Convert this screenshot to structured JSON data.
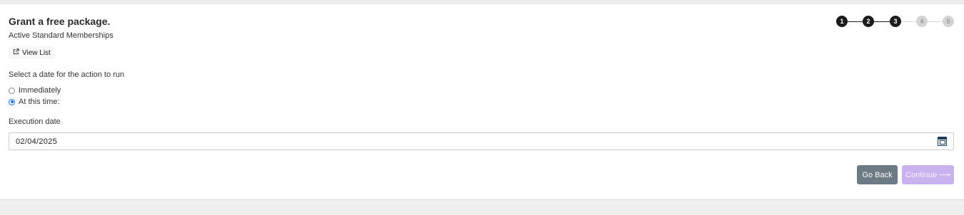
{
  "header": {
    "title": "Grant a free package.",
    "subtitle": "Active Standard Memberships",
    "view_list_label": "View List"
  },
  "stepper": {
    "steps": [
      "1",
      "2",
      "3",
      "4",
      "5"
    ],
    "current": 3,
    "active_color": "#1c1c1c",
    "inactive_color": "#d4d4d4"
  },
  "schedule": {
    "prompt": "Select a date for the action to run",
    "options": [
      {
        "label": "Immediately",
        "checked": false
      },
      {
        "label": "At this time:",
        "checked": true
      }
    ]
  },
  "execution": {
    "label": "Execution date",
    "value": "02/04/2025"
  },
  "buttons": {
    "back_label": "Go Back",
    "continue_label": "Continue ⟶"
  },
  "colors": {
    "radio_accent": "#1a73e8",
    "back_button": "#6c7a84",
    "continue_button": "#c9b3ef"
  }
}
